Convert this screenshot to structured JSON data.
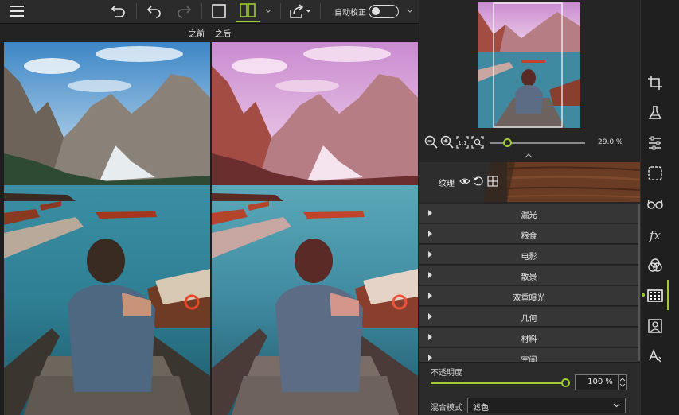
{
  "toolbar": {
    "menu_icon": "hamburger-menu-icon",
    "history_icon": "history-undo-icon",
    "undo_icon": "undo-icon",
    "redo_icon": "redo-icon",
    "single_view_icon": "single-view-icon",
    "split_view_icon": "split-view-icon",
    "share_icon": "share-export-icon",
    "auto_correct_label": "自动校正",
    "auto_correct_on": false
  },
  "compare": {
    "before_label": "之前",
    "after_label": "之后"
  },
  "navigator": {
    "zoom_out_icon": "zoom-out-icon",
    "zoom_in_icon": "zoom-in-icon",
    "actual_size_icon": "actual-size-icon",
    "fit_icon": "fit-to-screen-icon",
    "zoom_value": "29.0 %",
    "zoom_fraction": 0.18
  },
  "texture_panel": {
    "title": "纹理",
    "items": [
      {
        "label": "漏光"
      },
      {
        "label": "粮食"
      },
      {
        "label": "电影"
      },
      {
        "label": "散景"
      },
      {
        "label": "双重曝光"
      },
      {
        "label": "几何"
      },
      {
        "label": "材料"
      },
      {
        "label": "空间"
      }
    ]
  },
  "adjust": {
    "opacity_label": "不透明度",
    "opacity_value": "100 %",
    "opacity_fraction": 1.0,
    "blend_label": "混合模式",
    "blend_value": "滤色"
  },
  "tools": [
    {
      "name": "crop-icon"
    },
    {
      "name": "flask-icon"
    },
    {
      "name": "sliders-icon"
    },
    {
      "name": "vignette-frame-icon"
    },
    {
      "name": "glasses-icon"
    },
    {
      "name": "fx-icon"
    },
    {
      "name": "color-circles-icon"
    },
    {
      "name": "texture-grid-icon"
    },
    {
      "name": "portrait-icon"
    },
    {
      "name": "text-icon"
    }
  ],
  "colors": {
    "accent": "#9fcc2e",
    "panel_bg": "#252525",
    "accordion_bg": "#363636"
  }
}
